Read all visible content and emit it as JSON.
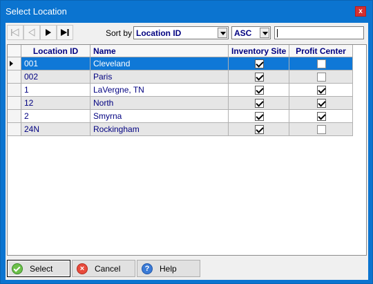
{
  "window": {
    "title": "Select Location",
    "close_glyph": "x"
  },
  "toolbar": {
    "sort_label": "Sort by",
    "sort_field": "Location ID",
    "sort_order": "ASC",
    "search_value": ""
  },
  "grid": {
    "columns": [
      "Location ID",
      "Name",
      "Inventory Site",
      "Profit Center"
    ],
    "rows": [
      {
        "id": "001",
        "name": "Cleveland",
        "inventory_site": true,
        "profit_center": false
      },
      {
        "id": "002",
        "name": "Paris",
        "inventory_site": true,
        "profit_center": false
      },
      {
        "id": "1",
        "name": "LaVergne, TN",
        "inventory_site": true,
        "profit_center": true
      },
      {
        "id": "12",
        "name": "North",
        "inventory_site": true,
        "profit_center": true
      },
      {
        "id": "2",
        "name": "Smyrna",
        "inventory_site": true,
        "profit_center": true
      },
      {
        "id": "24N",
        "name": "Rockingham",
        "inventory_site": true,
        "profit_center": false
      }
    ],
    "selected_row": 0
  },
  "footer": {
    "select_label": "Select",
    "cancel_label": "Cancel",
    "help_label": "Help",
    "help_glyph": "?",
    "cancel_glyph": "×"
  },
  "icons": {
    "first": "first-record-icon",
    "prev": "previous-record-icon",
    "next": "next-record-icon",
    "last": "last-record-icon"
  },
  "colors": {
    "titlebar": "#0b74d0",
    "selection": "#0f78d7",
    "text": "#000080"
  }
}
